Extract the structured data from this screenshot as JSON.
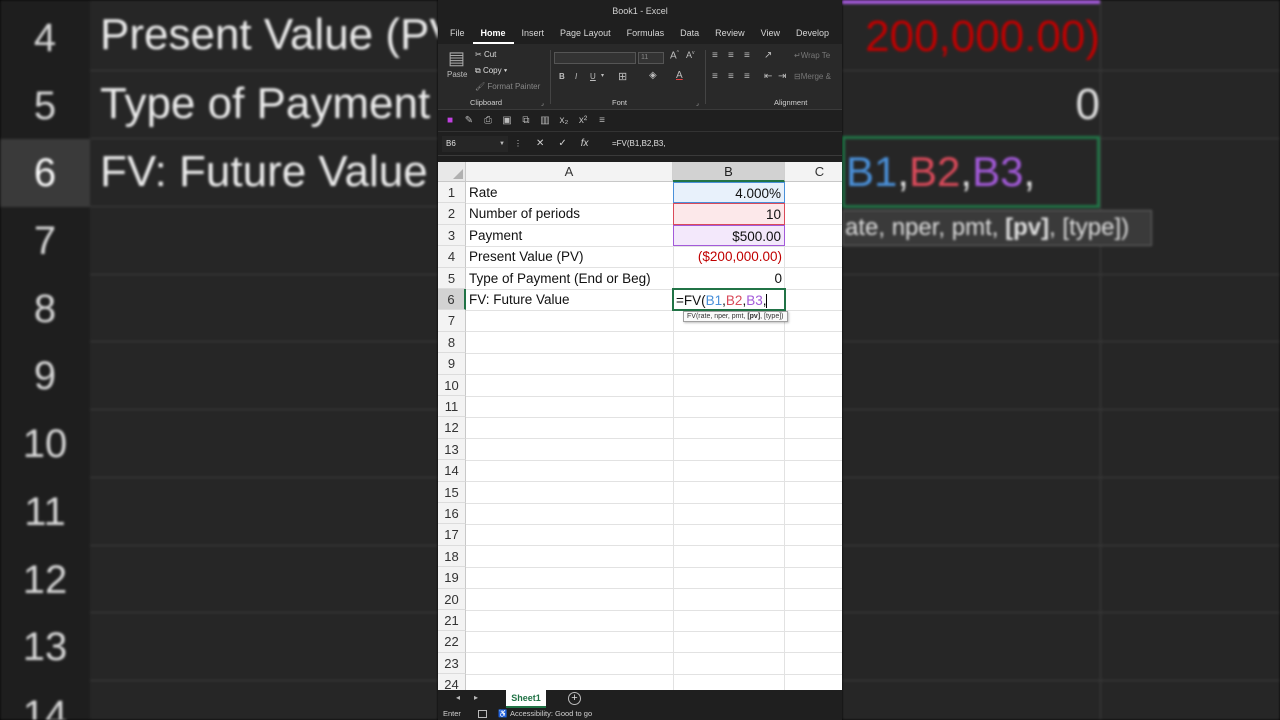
{
  "window": {
    "title": "Book1  -  Excel"
  },
  "menu": [
    "File",
    "Home",
    "Insert",
    "Page Layout",
    "Formulas",
    "Data",
    "Review",
    "View",
    "Develop"
  ],
  "ribbon": {
    "clipboard": {
      "label": "Clipboard",
      "paste": "Paste",
      "cut": "Cut",
      "copy": "Copy",
      "format_painter": "Format Painter"
    },
    "font": {
      "label": "Font",
      "size": "11",
      "bold": "B",
      "italic": "I",
      "underline": "U"
    },
    "alignment": {
      "label": "Alignment",
      "wrap_text": "Wrap Te",
      "merge": "Merge &"
    }
  },
  "formula_bar": {
    "name_box": "B6",
    "formula": "=FV(B1,B2,B3,"
  },
  "columns": [
    "A",
    "B",
    "C"
  ],
  "rows": [
    {
      "num": "1",
      "label": "Rate",
      "value": "4.000%"
    },
    {
      "num": "2",
      "label": "Number of periods",
      "value": "10"
    },
    {
      "num": "3",
      "label": "Payment",
      "value": "$500.00"
    },
    {
      "num": "4",
      "label": "Present Value (PV)",
      "value": "($200,000.00)"
    },
    {
      "num": "5",
      "label": "Type of Payment (End or Beg)",
      "value": "0"
    },
    {
      "num": "6",
      "label": "FV: Future Value",
      "value": ""
    }
  ],
  "empty_rows": [
    "7",
    "8",
    "9",
    "10",
    "11",
    "12",
    "13",
    "14",
    "15",
    "16",
    "17",
    "18",
    "19",
    "20",
    "21",
    "22",
    "23",
    "24"
  ],
  "editing": {
    "prefix": "=FV(",
    "ref1": "B1",
    "sep1": ",",
    "ref2": "B2",
    "sep2": ",",
    "ref3": "B3",
    "sep3": ","
  },
  "tooltip": {
    "pre": "FV(rate, nper, pmt, ",
    "bold": "[pv]",
    "post": ", [type])"
  },
  "sheet": {
    "tab": "Sheet1"
  },
  "status": {
    "mode": "Enter",
    "accessibility": "Accessibility: Good to go"
  },
  "background": {
    "row_numbers": [
      "4",
      "5",
      "6",
      "7",
      "8",
      "9",
      "10",
      "11",
      "12",
      "13",
      "14"
    ],
    "left_texts": [
      "Present Value (PV",
      "Type of Payment",
      "FV: Future Value"
    ],
    "right_texts": [
      "200,000.00)",
      "0"
    ],
    "right_formula": {
      "ref1": "B1",
      "sep1": ",",
      "ref2": "B2",
      "sep2": ",",
      "ref3": "B3",
      "sep3": ","
    },
    "right_tooltip": {
      "pre": "ate, nper, pmt, ",
      "bold": "[pv]",
      "post": ", [type])"
    }
  },
  "colors": {
    "accent": "#217346",
    "ref_b1": "#4a90d9",
    "ref_b2": "#d94a5a",
    "ref_b3": "#a35ad9",
    "negative": "#c00000"
  }
}
